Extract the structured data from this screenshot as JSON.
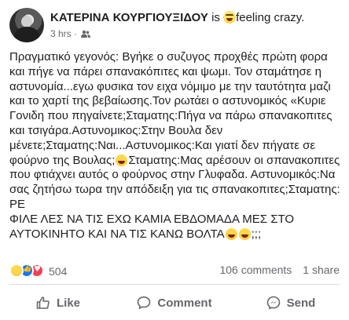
{
  "post": {
    "author": "ΚΑΤΕΡΙΝΑ ΚΟΥΡΓΙΟΥΞΙΔΟΥ",
    "is_word": "is",
    "feeling": "feeling crazy.",
    "time": "3 hrs",
    "separator": "·",
    "privacy_icon": "friends-icon",
    "text_part1": "Πραγματικό γεγονός: Βγήκε ο συζυγος προχθές πρώτη φορα και πήγε να πάρει σπανακόπιτες και ψωμι. Τον σταμάτησε η αστυνομία...εγω φυσικα τον ειχα νόμιμο με την ταυτότητα μαζι και το χαρτί της βεβαίωσης.Τον ρωτάει ο αστυνομικός «Κυριε Γονιδη που πηγαίνετε;Σταματης:Πήγα να πάρω σπανακοπιτες και τσιγάρα.Αστυνομικος:Στην Βουλα δεν μένετε;Σταματης:Ναι...Αστυνομικος:Και γιατί δεν πήγατε σε φούρνο της Βουλας;",
    "text_part2": "Σταματης:Μας αρέσουν οι σπανακοπιτες που φτιάχνει αυτός ο φούρνος στην Γλυφαδα. Αστυνομικός:Να σας ζητήσω τωρα την απόδειξη για τις σπανακοπιτες;Σταματης: ΡΕ",
    "text_part3": "ΦΙΛΕ ΛΕΣ ΝΑ ΤΙΣ ΕΧΩ ΚΑΜΙΑ ΕΒΔΟΜΑΔΑ ΜΕΣ ΣΤΟ ΑΥΤΟΚΙΝΗΤΟ ΚΑΙ ΝΑ ΤΙΣ ΚΑΝΩ ΒΟΛΤΑ",
    "text_end": ";;;"
  },
  "stats": {
    "reaction_icons": [
      "haha-icon",
      "like-icon",
      "love-icon"
    ],
    "reactions_count": "504",
    "comments": "106 comments",
    "shares": "1 share"
  },
  "actions": {
    "like": "Like",
    "comment": "Comment",
    "send": "Send"
  },
  "colors": {
    "text": "#1c1e21",
    "meta": "#65676b",
    "divider": "#dadde1",
    "like_blue": "#1877f2",
    "love_red": "#f33e58",
    "haha_yellow": "#ffd84a"
  }
}
